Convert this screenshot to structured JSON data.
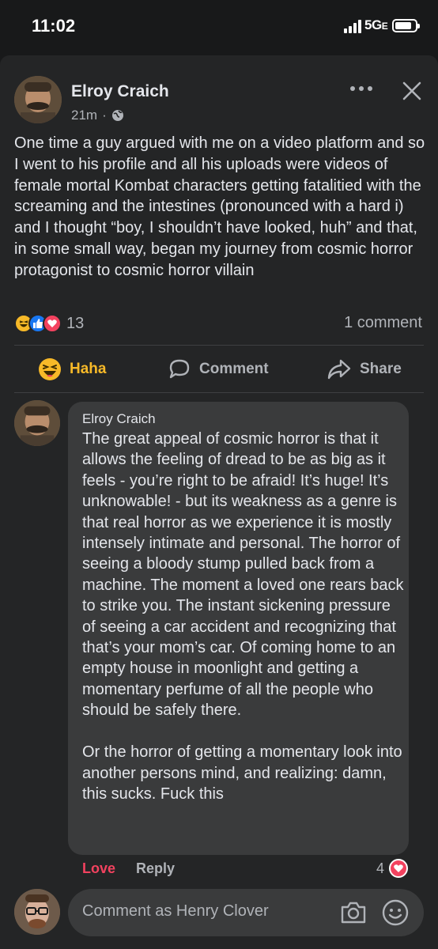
{
  "status": {
    "time": "11:02",
    "network": "5G",
    "network_sub": "E"
  },
  "post": {
    "author": "Elroy Craich",
    "time_ago": "21m",
    "privacy": "globe-icon",
    "text": "One time a guy argued with me on a video platform and so I went to his profile and all his uploads were videos of female mortal Kombat characters getting fatalitied with the screaming and the intestines (pronounced with a hard i) and I thought “boy, I shouldn’t have looked, huh” and that, in some small way, began my journey from cosmic horror protagonist to cosmic horror villain",
    "reactions": [
      "haha",
      "like",
      "love"
    ],
    "reaction_count": "13",
    "comment_count": "1 comment"
  },
  "actions": {
    "haha_label": "Haha",
    "comment_label": "Comment",
    "share_label": "Share"
  },
  "comment": {
    "author": "Elroy Craich",
    "text": "The great appeal of cosmic horror is that it allows the feeling of dread to be as big as it feels - you’re right to be afraid! It’s huge! It’s unknowable! - but its weakness as a genre is that real horror as we experience it is mostly intensely intimate and personal. The horror of seeing a bloody stump pulled back from a machine. The moment a loved one rears back to strike you. The instant sickening pressure of seeing a car accident and recognizing that that’s your mom’s car. Of coming home to an empty house in moonlight and getting a momentary perfume of all the people who should be safely there.\n\nOr the horror of getting a momentary look into another persons mind, and realizing: damn, this sucks. Fuck this",
    "love_label": "Love",
    "reply_label": "Reply",
    "reaction_count": "4"
  },
  "composer": {
    "placeholder": "Comment as Henry Clover"
  },
  "colors": {
    "background": "#18191a",
    "card": "#242526",
    "bubble": "#3a3b3c",
    "love": "#f3425f",
    "haha": "#f7b928",
    "like": "#1877f2",
    "text": "#e4e6eb",
    "muted": "#b0b3b8"
  }
}
